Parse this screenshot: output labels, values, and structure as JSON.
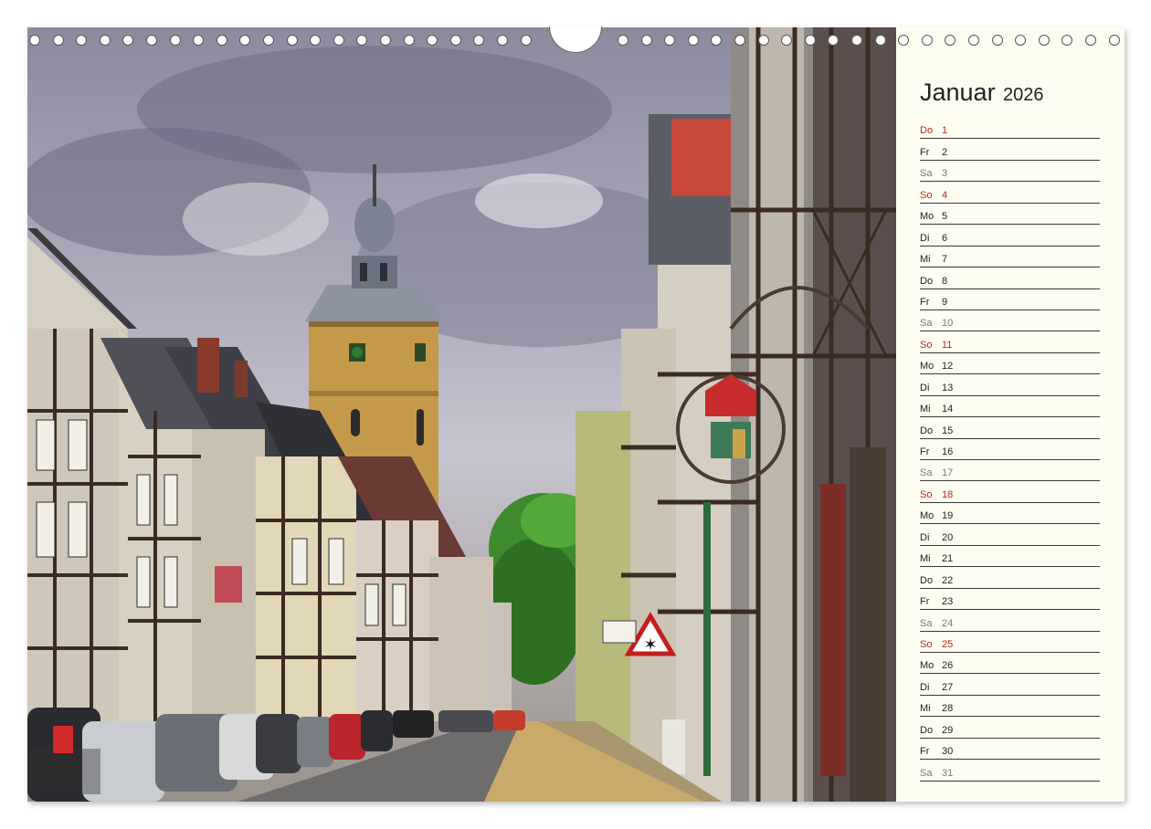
{
  "calendar": {
    "month": "Januar",
    "year": "2026",
    "days": [
      {
        "wd": "Do",
        "d": "1",
        "type": "holiday"
      },
      {
        "wd": "Fr",
        "d": "2",
        "type": "weekday"
      },
      {
        "wd": "Sa",
        "d": "3",
        "type": "saturday"
      },
      {
        "wd": "So",
        "d": "4",
        "type": "sunday"
      },
      {
        "wd": "Mo",
        "d": "5",
        "type": "weekday"
      },
      {
        "wd": "Di",
        "d": "6",
        "type": "weekday"
      },
      {
        "wd": "Mi",
        "d": "7",
        "type": "weekday"
      },
      {
        "wd": "Do",
        "d": "8",
        "type": "weekday"
      },
      {
        "wd": "Fr",
        "d": "9",
        "type": "weekday"
      },
      {
        "wd": "Sa",
        "d": "10",
        "type": "saturday"
      },
      {
        "wd": "So",
        "d": "11",
        "type": "sunday"
      },
      {
        "wd": "Mo",
        "d": "12",
        "type": "weekday"
      },
      {
        "wd": "Di",
        "d": "13",
        "type": "weekday"
      },
      {
        "wd": "Mi",
        "d": "14",
        "type": "weekday"
      },
      {
        "wd": "Do",
        "d": "15",
        "type": "weekday"
      },
      {
        "wd": "Fr",
        "d": "16",
        "type": "weekday"
      },
      {
        "wd": "Sa",
        "d": "17",
        "type": "saturday"
      },
      {
        "wd": "So",
        "d": "18",
        "type": "sunday"
      },
      {
        "wd": "Mo",
        "d": "19",
        "type": "weekday"
      },
      {
        "wd": "Di",
        "d": "20",
        "type": "weekday"
      },
      {
        "wd": "Mi",
        "d": "21",
        "type": "weekday"
      },
      {
        "wd": "Do",
        "d": "22",
        "type": "weekday"
      },
      {
        "wd": "Fr",
        "d": "23",
        "type": "weekday"
      },
      {
        "wd": "Sa",
        "d": "24",
        "type": "saturday"
      },
      {
        "wd": "So",
        "d": "25",
        "type": "sunday"
      },
      {
        "wd": "Mo",
        "d": "26",
        "type": "weekday"
      },
      {
        "wd": "Di",
        "d": "27",
        "type": "weekday"
      },
      {
        "wd": "Mi",
        "d": "28",
        "type": "weekday"
      },
      {
        "wd": "Do",
        "d": "29",
        "type": "weekday"
      },
      {
        "wd": "Fr",
        "d": "30",
        "type": "weekday"
      },
      {
        "wd": "Sa",
        "d": "31",
        "type": "saturday"
      }
    ]
  },
  "colors": {
    "sunday": "#c0221b",
    "saturday": "#777777",
    "weekday": "#222222",
    "panel_bg": "#fefdf1"
  },
  "photo": {
    "subject": "half-timbered-street-with-church-tower",
    "icons": [
      "no-entry-sign",
      "parking-sign",
      "shop-sign"
    ]
  }
}
